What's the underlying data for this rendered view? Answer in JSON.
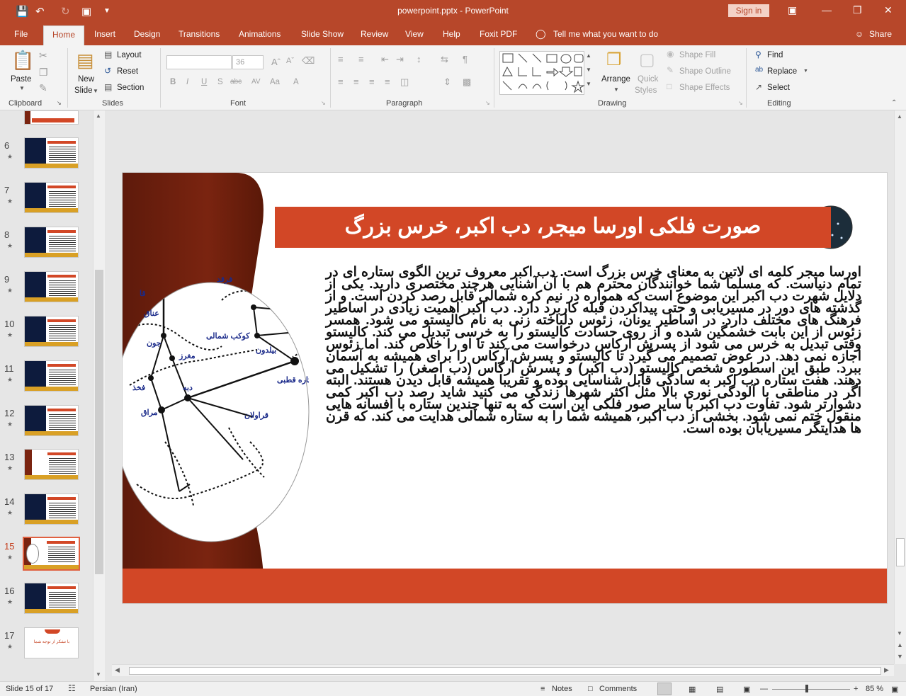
{
  "window": {
    "title": "powerpoint.pptx - PowerPoint",
    "sign_in": "Sign in"
  },
  "tabs": [
    "File",
    "Home",
    "Insert",
    "Design",
    "Transitions",
    "Animations",
    "Slide Show",
    "Review",
    "View",
    "Help",
    "Foxit PDF",
    "Tell me what you want to do",
    "Share"
  ],
  "ribbon": {
    "clipboard": {
      "paste": "Paste",
      "label": "Clipboard"
    },
    "slides": {
      "new_slide_1": "New",
      "new_slide_2": "Slide",
      "layout": "Layout",
      "reset": "Reset",
      "section": "Section",
      "label": "Slides"
    },
    "font": {
      "size": "36",
      "label": "Font"
    },
    "paragraph": {
      "label": "Paragraph"
    },
    "drawing": {
      "arrange": "Arrange",
      "quick_1": "Quick",
      "quick_2": "Styles",
      "shape_fill": "Shape Fill",
      "shape_outline": "Shape Outline",
      "shape_effects": "Shape Effects",
      "label": "Drawing"
    },
    "editing": {
      "find": "Find",
      "replace": "Replace",
      "select": "Select",
      "label": "Editing"
    }
  },
  "thumbnails": [
    {
      "num": "6"
    },
    {
      "num": "7"
    },
    {
      "num": "8"
    },
    {
      "num": "9"
    },
    {
      "num": "10"
    },
    {
      "num": "11"
    },
    {
      "num": "12"
    },
    {
      "num": "13"
    },
    {
      "num": "14"
    },
    {
      "num": "15"
    },
    {
      "num": "16"
    },
    {
      "num": "17"
    }
  ],
  "slide": {
    "title": "صورت فلکی اورسا میجر، دب اکبر، خرس بزرگ",
    "body": "اورسا میجر کلمه ای لاتین به معنای خرس بزرگ است. دب اکبر معروف ترین الگوی ستاره ای در تمام دنیاست. که مسلماً شما خوانندگان محترم هم با آن آشنایی هرچند مختصری دارید. یکی از دلایل شهرت دب اکبر این موضوع است که همواره در نیم کره شمالی قابل رصد کردن است. و از گذشته های دور در مسیریابی و حتی پیداکردن قبله کاربرد دارد. دب اکبر اهمیت زیادی در اساطیر فرهنگ های مختلف دارد. در اساطیر یونان، زئوس دلباخته زنی به نام کالیستو می شود. همسر زئوس از این بابت خشمگین شده و از روی حسادت کالیستو را به خرسی تبدیل می کند. کالیستو وقتی تبدیل به خرس می شود از پسرش آرکاس درخواست می کند تا او را خلاص کند. اما زئوس اجازه نمی دهد. در عوض تصمیم می گیرد تا کالیستو و پسرش آرکاس را برای همیشه به آسمان ببرد. طبق این اسطوره شخص کالیستو (دب اکبر) و پسرش آرکاس (دب اصغر) را تشکیل می دهند. هفت ستاره دب اکبر به سادگی قابل شناسایی بوده و تقریبا همیشه قابل دیدن هستند. البته اگر در مناطقی با آلودگی نوری بالا مثل اکثر شهرها زندگی می کنید شاید رصد دب اکبر کمی دشوارتر شود. تفاوت دب اکبر با سایر صور فلکی این است که به تنها چندین ستاره با افسانه هایی منقول ختم نمی شود. بخشی از دب اکبر، همیشه شما را به ستاره شمالی هدایت می کند. که قرن ها هدایتگر مسیریابان بوده است.",
    "map_labels": {
      "farqad": "فرقد",
      "kokab": "کوکب شمالی",
      "anaq": "عناق",
      "jun": "جون",
      "maghraz": "مغرز",
      "dobe": "دبه",
      "fakhz": "فخذ",
      "maraq": "مراق",
      "qaravolan": "قراولان",
      "bidun": "بیلدون",
      "qotbi": "ستاره قطبی",
      "qa": "قا"
    },
    "thumb17_text": "با تشکر از توجه شما"
  },
  "status": {
    "slide_of": "Slide 15 of 17",
    "language": "Persian (Iran)",
    "notes": "Notes",
    "comments": "Comments",
    "zoom": "85 %"
  },
  "colors": {
    "accent": "#b7472a",
    "slide_orange": "#d24726",
    "slide_brown": "#7a2410"
  }
}
